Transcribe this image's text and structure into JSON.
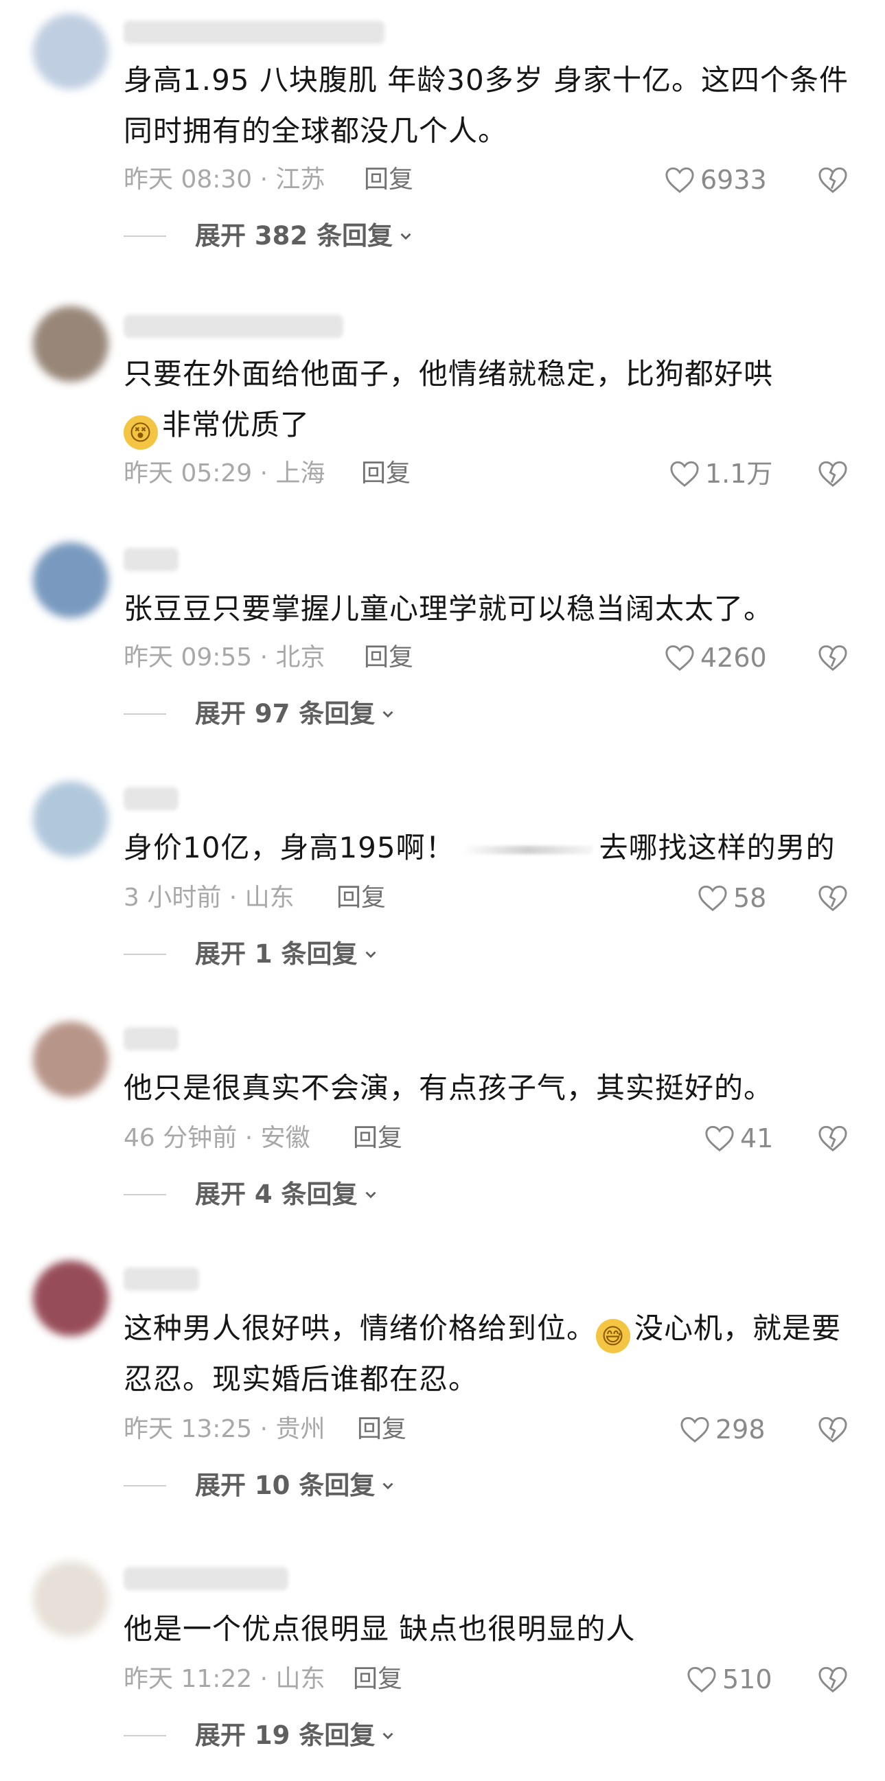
{
  "comments": [
    {
      "avatar_color": "#b9c9de",
      "text": "身高1.95 八块腹肌 年龄30多岁  身家十亿。这四个条件同时拥有的全球都没几个人。",
      "time_location": "昨天 08:30 · 江苏",
      "reply_label": "回复",
      "likes": "6933",
      "expand_label": "展开 382 条回复"
    },
    {
      "avatar_color": "#8d7a6a",
      "text_before_emoji": "只要在外面给他面子，他情绪就稳定，比狗都好哄",
      "emoji": "😵",
      "text_after_emoji": "非常优质了",
      "time_location": "昨天 05:29 · 上海",
      "reply_label": "回复",
      "likes": "1.1万"
    },
    {
      "avatar_color": "#6b8fb8",
      "text": "张豆豆只要掌握儿童心理学就可以稳当阔太太了。",
      "time_location": "昨天 09:55 · 北京",
      "reply_label": "回复",
      "likes": "4260",
      "expand_label": "展开 97 条回复"
    },
    {
      "avatar_color": "#a9c2d8",
      "text_before_blur": "身价10亿，身高195啊！",
      "text_after_blur": "去哪找这样的男的",
      "time_location": "3 小时前 · 山东",
      "reply_label": "回复",
      "likes": "58",
      "expand_label": "展开 1 条回复"
    },
    {
      "avatar_color": "#b08a7c",
      "text": "他只是很真实不会演，有点孩子气，其实挺好的。",
      "time_location": "46 分钟前 · 安徽",
      "reply_label": "回复",
      "likes": "41",
      "expand_label": "展开 4 条回复"
    },
    {
      "avatar_color": "#8c3a48",
      "text_before_emoji": "这种男人很好哄，情绪价格给到位。",
      "emoji": "😅",
      "text_after_emoji": "没心机，就是要忍忍。现实婚后谁都在忍。",
      "time_location": "昨天 13:25 · 贵州",
      "reply_label": "回复",
      "likes": "298",
      "expand_label": "展开 10 条回复"
    },
    {
      "avatar_color": "#e4ddd4",
      "text": "他是一个优点很明显 缺点也很明显的人",
      "time_location": "昨天 11:22 · 山东",
      "reply_label": "回复",
      "likes": "510",
      "expand_label": "展开 19 条回复"
    }
  ],
  "icons": {
    "like": "heart-outline-icon",
    "dislike": "broken-heart-icon",
    "expand": "chevron-down-icon"
  },
  "colors": {
    "text": "#161616",
    "meta": "#a8a8a8",
    "reply": "#727272",
    "expand": "#5f5f5f"
  }
}
